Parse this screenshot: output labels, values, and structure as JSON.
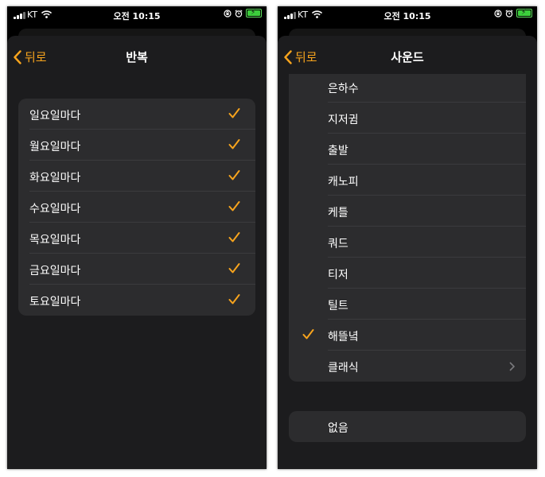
{
  "status_bar": {
    "carrier": "KT",
    "time": "오전 10:15"
  },
  "repeat_screen": {
    "back_label": "뒤로",
    "title": "반복",
    "days": [
      {
        "label": "일요일마다",
        "checked": true
      },
      {
        "label": "월요일마다",
        "checked": true
      },
      {
        "label": "화요일마다",
        "checked": true
      },
      {
        "label": "수요일마다",
        "checked": true
      },
      {
        "label": "목요일마다",
        "checked": true
      },
      {
        "label": "금요일마다",
        "checked": true
      },
      {
        "label": "토요일마다",
        "checked": true
      }
    ]
  },
  "sound_screen": {
    "back_label": "뒤로",
    "title": "사운드",
    "sounds": [
      {
        "label": "은하수",
        "selected": false
      },
      {
        "label": "지저귐",
        "selected": false
      },
      {
        "label": "출발",
        "selected": false
      },
      {
        "label": "캐노피",
        "selected": false
      },
      {
        "label": "케틀",
        "selected": false
      },
      {
        "label": "쿼드",
        "selected": false
      },
      {
        "label": "티저",
        "selected": false
      },
      {
        "label": "틸트",
        "selected": false
      },
      {
        "label": "해뜰녘",
        "selected": true
      }
    ],
    "classic_label": "클래식",
    "none_label": "없음"
  },
  "colors": {
    "accent": "#f7a41d",
    "background": "#1c1c1e",
    "cell": "#2c2c2e",
    "separator": "#3b3b3e"
  },
  "icons": [
    "signal-icon",
    "wifi-icon",
    "orientation-lock-icon",
    "alarm-icon",
    "battery-icon",
    "chevron-left-icon",
    "checkmark-icon",
    "chevron-right-icon"
  ]
}
